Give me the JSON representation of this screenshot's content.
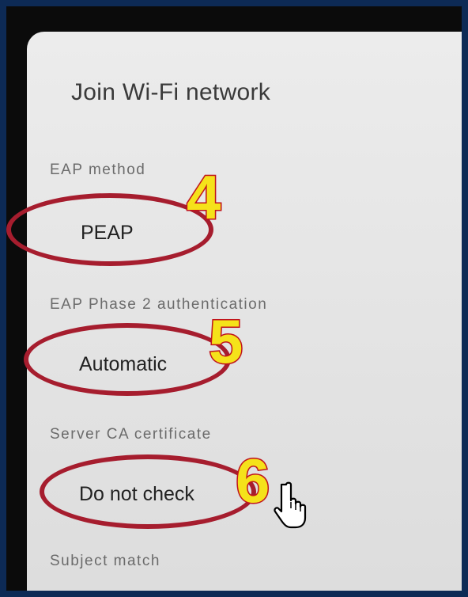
{
  "dialog": {
    "title": "Join Wi-Fi network"
  },
  "fields": {
    "eap_method": {
      "label": "EAP method",
      "value": "PEAP",
      "step": "4"
    },
    "phase2": {
      "label": "EAP Phase 2 authentication",
      "value": "Automatic",
      "step": "5"
    },
    "server_ca": {
      "label": "Server CA certificate",
      "value": "Do not check",
      "step": "6"
    },
    "subject_match": {
      "label": "Subject match"
    }
  },
  "colors": {
    "annotation_ring": "#a61d2e",
    "step_fill": "#f5e21a",
    "step_stroke": "#c0141c"
  },
  "icons": {
    "cursor": "hand-pointer-icon"
  }
}
